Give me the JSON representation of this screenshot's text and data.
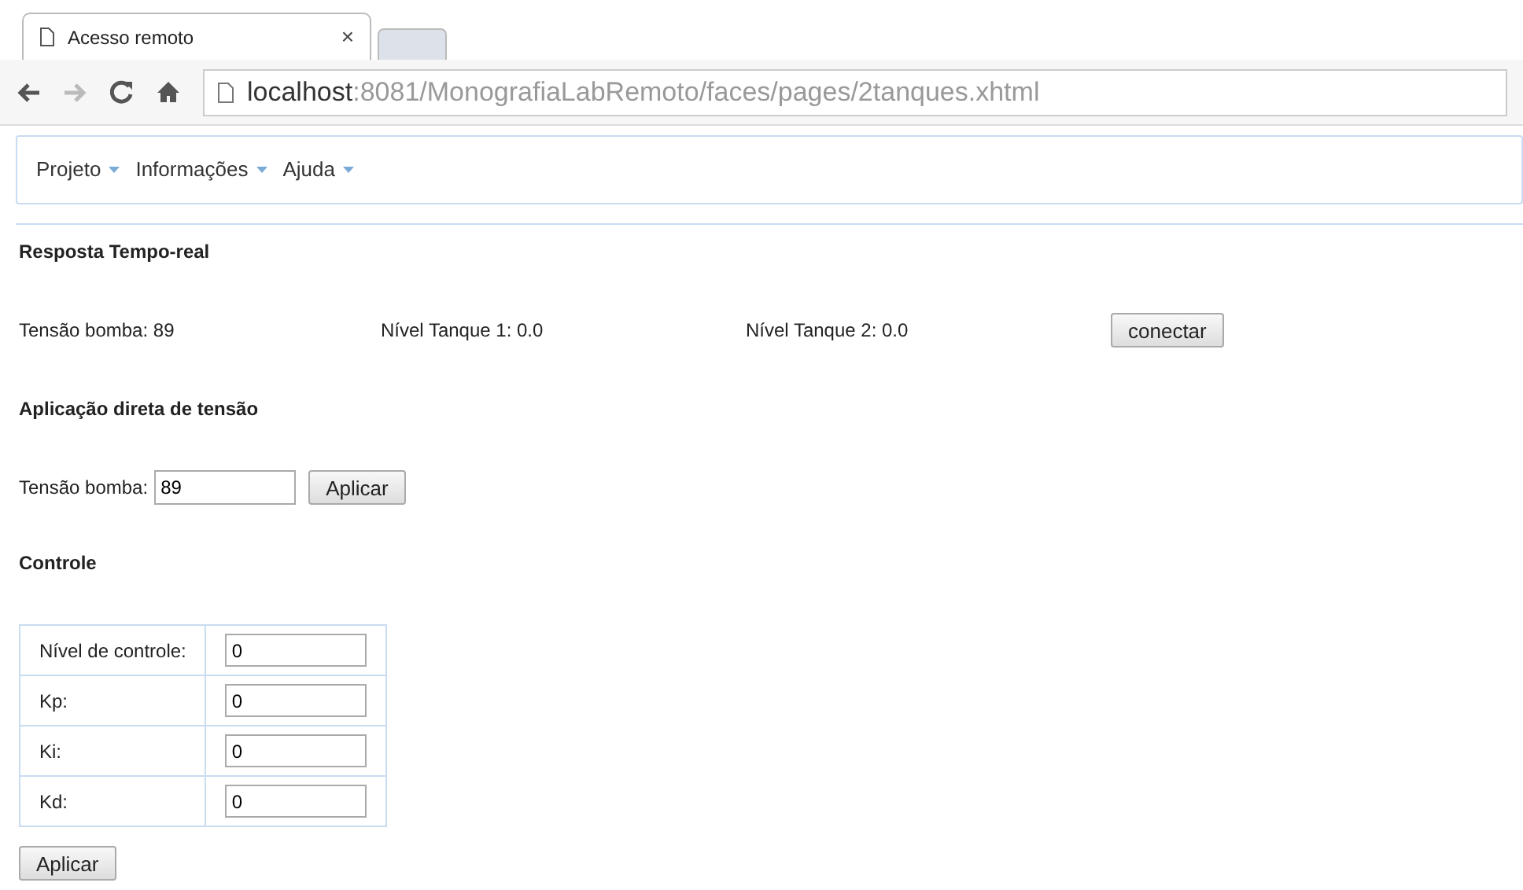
{
  "browser": {
    "tab_title": "Acesso remoto",
    "tab_close": "×",
    "url_host": "localhost",
    "url_path": ":8081/MonografiaLabRemoto/faces/pages/2tanques.xhtml"
  },
  "menu": [
    {
      "label": "Projeto"
    },
    {
      "label": "Informações"
    },
    {
      "label": "Ajuda"
    }
  ],
  "realtime": {
    "heading": "Resposta Tempo-real",
    "readings": [
      "Tensão bomba: 89",
      "Nível Tanque 1: 0.0",
      "Nível Tanque 2: 0.0"
    ],
    "button": "conectar"
  },
  "direct": {
    "heading": "Aplicação direta de tensão",
    "label": "Tensão bomba:",
    "value": "89",
    "button": "Aplicar"
  },
  "control": {
    "heading": "Controle",
    "rows": [
      {
        "label": "Nível de controle:",
        "value": "0"
      },
      {
        "label": "Kp:",
        "value": "0"
      },
      {
        "label": "Ki:",
        "value": "0"
      },
      {
        "label": "Kd:",
        "value": "0"
      }
    ],
    "button": "Aplicar"
  }
}
